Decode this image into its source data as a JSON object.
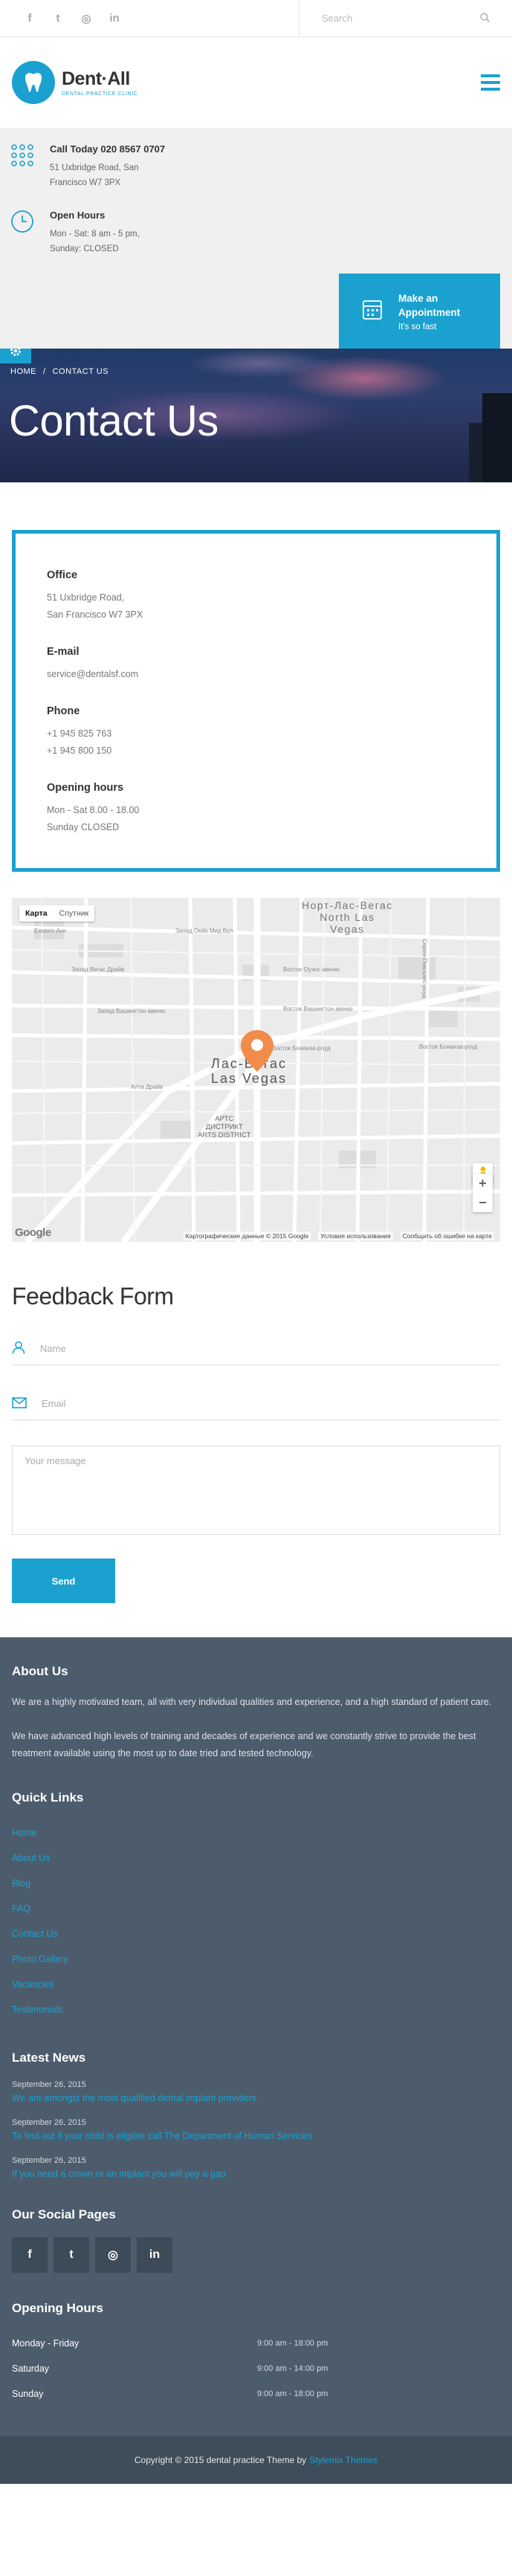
{
  "colors": {
    "accent": "#1ba1cf",
    "footer_bg": "#4c5c6c",
    "copyright_bg": "#3f4d5a"
  },
  "topbar": {
    "social_icons": [
      "facebook-icon",
      "twitter-icon",
      "instagram-icon",
      "linkedin-icon"
    ],
    "social_glyphs": [
      "f",
      "t",
      "◎",
      "in"
    ],
    "search_placeholder": "Search"
  },
  "header": {
    "logo_name": "Dent·All",
    "logo_tagline": "DENTAL PRACTICE CLINIC"
  },
  "info": {
    "call_title": "Call Today 020 8567 0707",
    "call_address_1": "51 Uxbridge Road, San",
    "call_address_2": "Francisco W7 3PX",
    "hours_title": "Open Hours",
    "hours_line_1": "Mon - Sat: 8 am - 5 pm,",
    "hours_line_2": "Sunday: CLOSED",
    "appointment_title_1": "Make an",
    "appointment_title_2": "Appointment",
    "appointment_sub": "It's so fast"
  },
  "hero": {
    "crumb_home": "HOME",
    "crumb_sep": "/",
    "crumb_current": "CONTACT US",
    "title": "Contact Us"
  },
  "contact": {
    "office_title": "Office",
    "office_line_1": "51 Uxbridge Road,",
    "office_line_2": "San Francisco W7 3PX",
    "email_title": "E-mail",
    "email_value": "service@dentalsf.com",
    "phone_title": "Phone",
    "phone_1": "+1 945 825 763",
    "phone_2": "+1 945 800 150",
    "hours_title": "Opening hours",
    "hours_1": "Mon - Sat 8.00 - 18.00",
    "hours_2": "Sunday CLOSED"
  },
  "map": {
    "tab_map": "Карта",
    "tab_satellite": "Спутник",
    "city_main_1": "Лас-Вегас",
    "city_main_2": "Las Vegas",
    "city_north_1": "Норт-Лас-Вегас",
    "city_north_2": "North Las",
    "city_north_3": "Vegas",
    "district_1": "АРТС",
    "district_2": "ДИСТРИКТ",
    "district_3": "ARTS DISTRICT",
    "street_1": "Запад Оейк Мид Бул",
    "street_2": "Запад Вегас Драйв",
    "street_3": "Запад Вашингтон авеню",
    "street_4": "Восток Оуэнс авеню",
    "street_5": "Восток Вашингтон авеню",
    "street_6": "Восток Бонанза-роуд",
    "street_7": "Алта Драйв",
    "street_8": "Восток Бонанза-роуд",
    "street_9": "Серен-Пекгалис-роуд",
    "street_10": "Eastern Ave",
    "footer_data": "Картографические данные © 2015 Google",
    "footer_terms": "Условия использования",
    "footer_report": "Сообщить об ошибке на карте",
    "google": "Google",
    "zoom_in": "+",
    "zoom_out": "−"
  },
  "feedback": {
    "title": "Feedback Form",
    "name_placeholder": "Name",
    "email_placeholder": "Email",
    "message_placeholder": "Your message",
    "send_label": "Send"
  },
  "footer": {
    "about_title": "About Us",
    "about_p1": "We are a highly motivated team, all with very individual qualities and experience, and a high standard of patient care.",
    "about_p2": "We have advanced high levels of training and decades of experience and we constantly strive to provide the best treatment available using the most up to date tried and tested technology.",
    "links_title": "Quick Links",
    "links": [
      "Home",
      "About Us",
      "Blog",
      "FAQ",
      "Contact Us",
      "Photo Gallery",
      "Vacancies",
      "Testimonials"
    ],
    "news_title": "Latest News",
    "news": [
      {
        "date": "September 26, 2015",
        "title": "We are amongst the most qualified dental implant providers"
      },
      {
        "date": "September 26, 2015",
        "title": "To find out if your child is eligible call The Department of Human Services"
      },
      {
        "date": "September 26, 2015",
        "title": "If you need a crown or an implant you will pay a gap"
      }
    ],
    "social_title": "Our Social Pages",
    "social_icons": [
      "facebook-icon",
      "twitter-icon",
      "instagram-icon",
      "linkedin-icon"
    ],
    "social_glyphs": [
      "f",
      "t",
      "◎",
      "in"
    ],
    "hours_title": "Opening Hours",
    "hours": [
      {
        "day": "Monday - Friday",
        "time": "9:00 am - 18:00 pm"
      },
      {
        "day": "Saturday",
        "time": "9:00 am - 14:00 pm"
      },
      {
        "day": "Sunday",
        "time": "9:00 am - 18:00 pm"
      }
    ],
    "copyright": "Copyright © 2015 dental practice Theme by",
    "copyright_theme": "Stylemix Themes"
  }
}
